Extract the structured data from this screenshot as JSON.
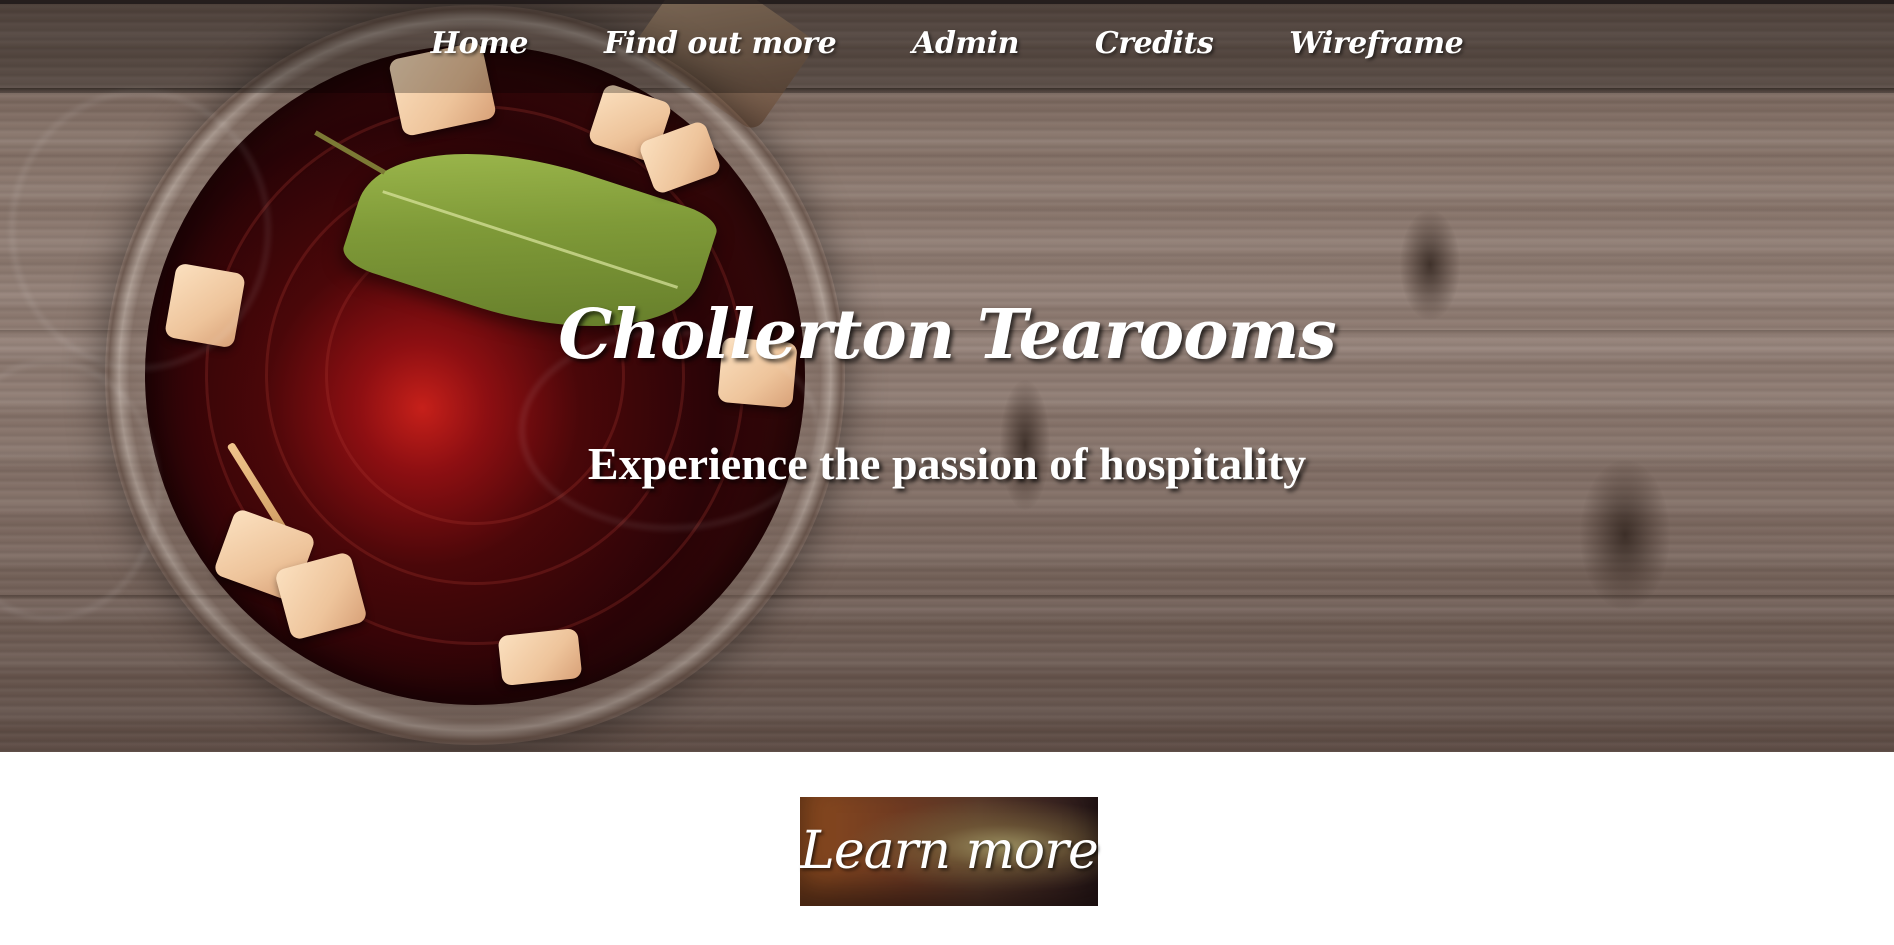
{
  "nav": {
    "items": [
      {
        "label": "Home"
      },
      {
        "label": "Find out more"
      },
      {
        "label": "Admin"
      },
      {
        "label": "Credits"
      },
      {
        "label": "Wireframe"
      }
    ]
  },
  "hero": {
    "title": "Chollerton Tearooms",
    "subtitle": "Experience the passion of hospitality"
  },
  "cta": {
    "label": "Learn more"
  },
  "colors": {
    "text": "#ffffff",
    "page_background": "#ffffff",
    "wood": "#8a776d",
    "tea": "#4a0709",
    "leaf": "#7f9a38"
  }
}
